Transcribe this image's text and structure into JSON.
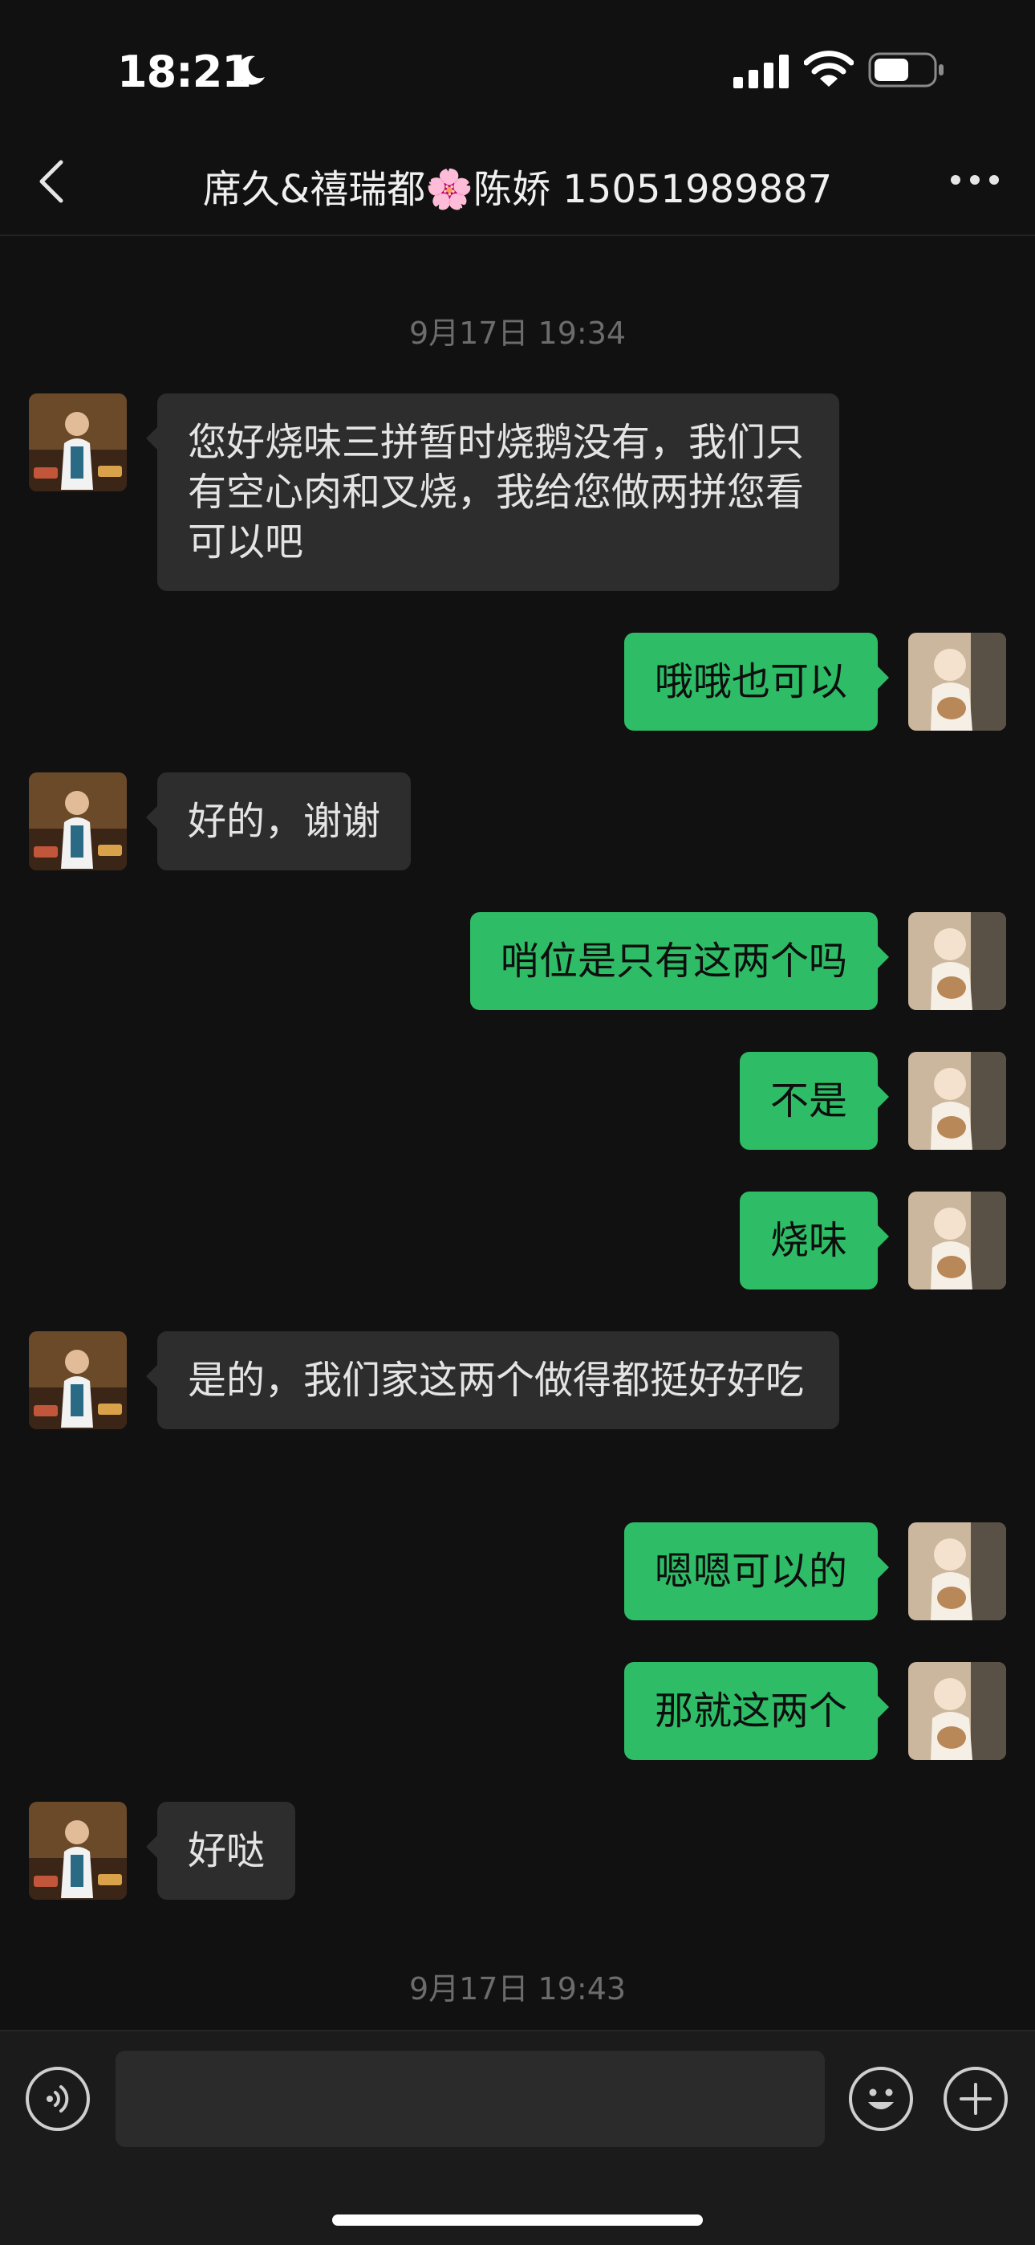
{
  "status_bar": {
    "time": "18:21"
  },
  "nav": {
    "title": "席久&禧瑞都🌸陈娇 15051989887"
  },
  "timestamps": [
    "9月17日 19:34",
    "9月17日 19:43"
  ],
  "messages": [
    {
      "side": "left",
      "text": "您好烧味三拼暂时烧鹅没有，我们只有空心肉和叉烧，我给您做两拼您看可以吧"
    },
    {
      "side": "right",
      "text": "哦哦也可以"
    },
    {
      "side": "left",
      "text": "好的，谢谢"
    },
    {
      "side": "right",
      "text": "哨位是只有这两个吗"
    },
    {
      "side": "right",
      "text": "不是"
    },
    {
      "side": "right",
      "text": "烧味"
    },
    {
      "side": "left",
      "text": "是的，我们家这两个做得都挺好好吃"
    },
    {
      "side": "right",
      "text": "嗯嗯可以的"
    },
    {
      "side": "right",
      "text": "那就这两个"
    },
    {
      "side": "left",
      "text": "好哒"
    }
  ],
  "input": {
    "value": ""
  },
  "colors": {
    "background": "#111111",
    "incoming_bubble": "#2d2d2d",
    "outgoing_bubble": "#2ebd66"
  },
  "icons": [
    "moon-icon",
    "signal-icon",
    "wifi-icon",
    "battery-icon",
    "back-icon",
    "more-icon",
    "voice-icon",
    "emoji-icon",
    "plus-icon"
  ]
}
